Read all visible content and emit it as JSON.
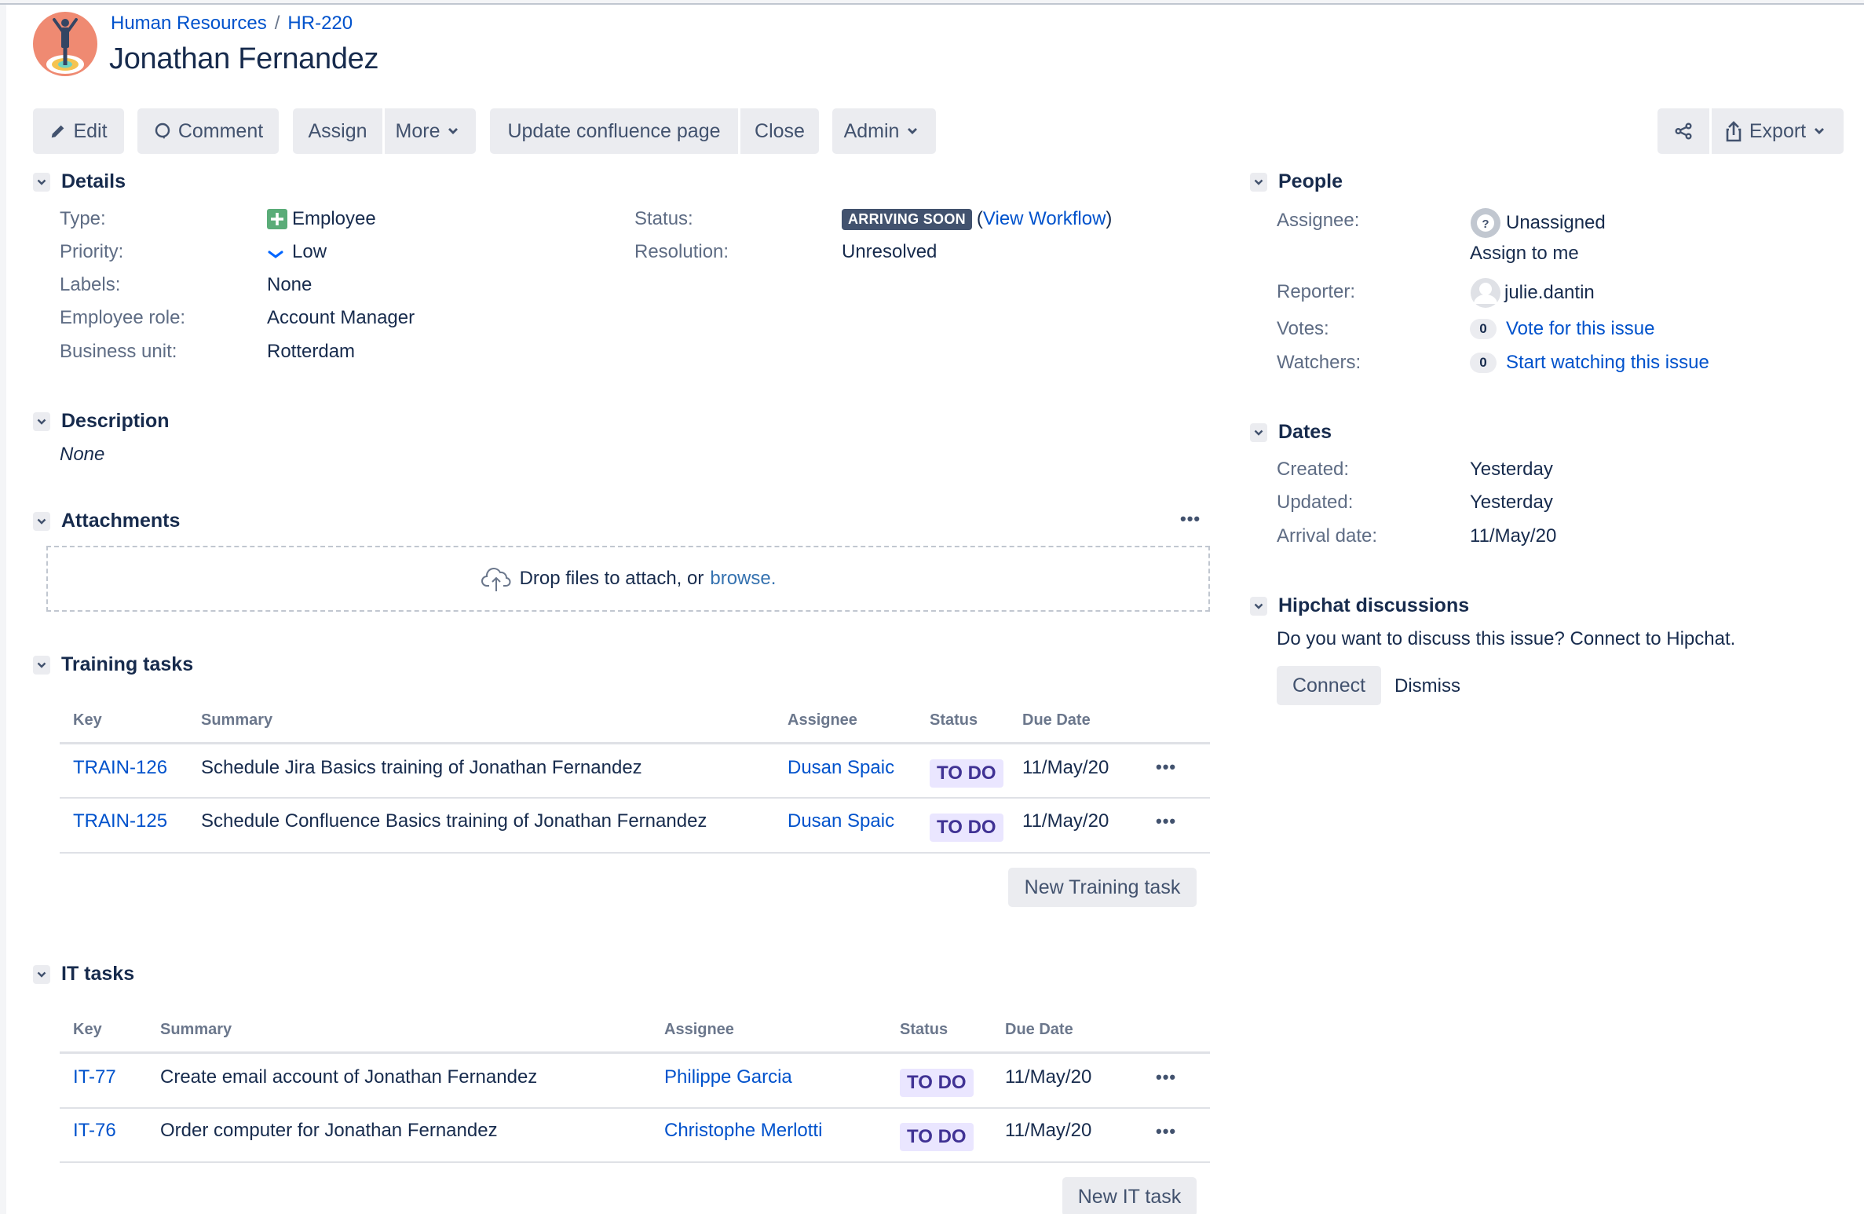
{
  "breadcrumb": {
    "project": "Human Resources",
    "separator": "/",
    "issue_key": "HR-220"
  },
  "issue": {
    "title": "Jonathan Fernandez"
  },
  "toolbar": {
    "edit": "Edit",
    "comment": "Comment",
    "assign": "Assign",
    "more": "More",
    "update_confluence": "Update confluence page",
    "close": "Close",
    "admin": "Admin",
    "export": "Export"
  },
  "details": {
    "heading": "Details",
    "type": {
      "label": "Type:",
      "value": "Employee"
    },
    "priority": {
      "label": "Priority:",
      "value": "Low"
    },
    "labels": {
      "label": "Labels:",
      "value": "None"
    },
    "employee_role": {
      "label": "Employee role:",
      "value": "Account Manager"
    },
    "business_unit": {
      "label": "Business unit:",
      "value": "Rotterdam"
    },
    "status": {
      "label": "Status:",
      "value": "ARRIVING SOON",
      "workflow_open": "(",
      "workflow_link": "View Workflow",
      "workflow_close": ")"
    },
    "resolution": {
      "label": "Resolution:",
      "value": "Unresolved"
    }
  },
  "description": {
    "heading": "Description",
    "value": "None"
  },
  "attachments": {
    "heading": "Attachments",
    "drop_text": "Drop files to attach, or",
    "browse": "browse."
  },
  "training_tasks": {
    "heading": "Training tasks",
    "columns": [
      "Key",
      "Summary",
      "Assignee",
      "Status",
      "Due Date"
    ],
    "rows": [
      {
        "key": "TRAIN-126",
        "summary": "Schedule Jira Basics training of Jonathan Fernandez",
        "assignee": "Dusan Spaic",
        "status": "TO DO",
        "due": "11/May/20"
      },
      {
        "key": "TRAIN-125",
        "summary": "Schedule Confluence Basics training of Jonathan Fernandez",
        "assignee": "Dusan Spaic",
        "status": "TO DO",
        "due": "11/May/20"
      }
    ],
    "new_button": "New Training task"
  },
  "it_tasks": {
    "heading": "IT tasks",
    "columns": [
      "Key",
      "Summary",
      "Assignee",
      "Status",
      "Due Date"
    ],
    "rows": [
      {
        "key": "IT-77",
        "summary": "Create email account of Jonathan Fernandez",
        "assignee": "Philippe Garcia",
        "status": "TO DO",
        "due": "11/May/20"
      },
      {
        "key": "IT-76",
        "summary": "Order computer for Jonathan Fernandez",
        "assignee": "Christophe Merlotti",
        "status": "TO DO",
        "due": "11/May/20"
      }
    ],
    "new_button": "New IT task"
  },
  "people": {
    "heading": "People",
    "assignee": {
      "label": "Assignee:",
      "value": "Unassigned",
      "assign_to_me": "Assign to me"
    },
    "reporter": {
      "label": "Reporter:",
      "value": "julie.dantin"
    },
    "votes": {
      "label": "Votes:",
      "count": "0",
      "link": "Vote for this issue"
    },
    "watchers": {
      "label": "Watchers:",
      "count": "0",
      "link": "Start watching this issue"
    }
  },
  "dates": {
    "heading": "Dates",
    "created": {
      "label": "Created:",
      "value": "Yesterday"
    },
    "updated": {
      "label": "Updated:",
      "value": "Yesterday"
    },
    "arrival": {
      "label": "Arrival date:",
      "value": "11/May/20"
    }
  },
  "hipchat": {
    "heading": "Hipchat discussions",
    "text": "Do you want to discuss this issue? Connect to Hipchat.",
    "connect": "Connect",
    "dismiss": "Dismiss"
  },
  "colors": {
    "link": "#0052cc",
    "status_lozenge": "#42526e",
    "todo_bg": "#eae6ff",
    "todo_text": "#403294",
    "type_icon": "#5aac78",
    "button_bg": "#ebecf0"
  }
}
